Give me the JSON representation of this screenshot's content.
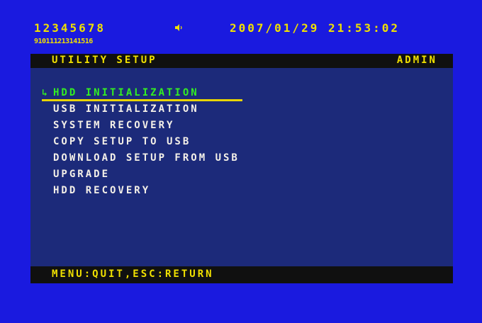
{
  "header": {
    "channels_row1": "12345678",
    "channels_row2": "910111213141516",
    "datetime": "2007/01/29  21:53:02",
    "audio_icon": "speaker-icon"
  },
  "panel": {
    "title": "UTILITY SETUP",
    "role": "ADMIN",
    "items": [
      {
        "label": "HDD INITIALIZATION",
        "selected": true
      },
      {
        "label": "USB INITIALIZATION",
        "selected": false
      },
      {
        "label": "SYSTEM RECOVERY",
        "selected": false
      },
      {
        "label": "COPY SETUP TO USB",
        "selected": false
      },
      {
        "label": "DOWNLOAD SETUP FROM USB",
        "selected": false
      },
      {
        "label": "UPGRADE",
        "selected": false
      },
      {
        "label": "HDD RECOVERY",
        "selected": false
      }
    ],
    "footer": "MENU:QUIT,ESC:RETURN",
    "cursor_icon": "return-arrow-icon"
  },
  "colors": {
    "background": "#1a1adf",
    "panel": "#1c2a7a",
    "bar": "#101010",
    "accent_yellow": "#f0e000",
    "selected_green": "#33ee22",
    "text": "#f4f0e8"
  }
}
